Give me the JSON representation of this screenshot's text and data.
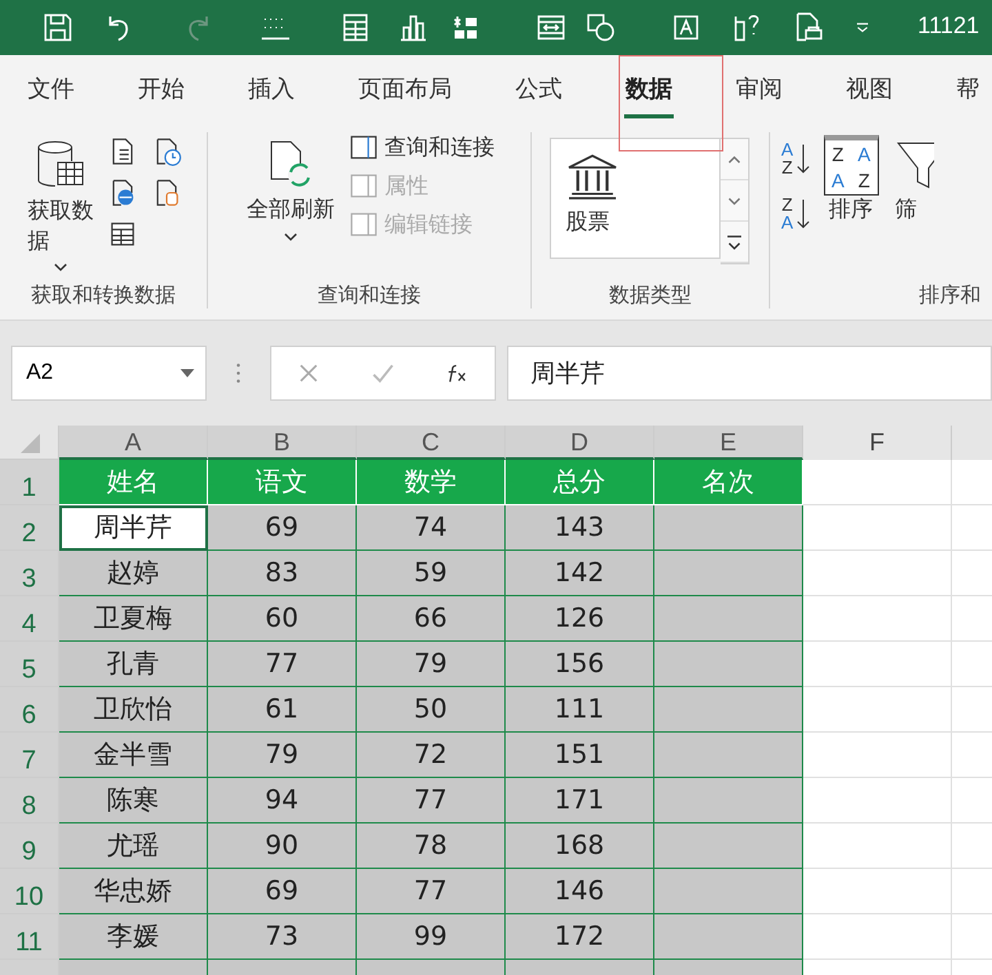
{
  "title_bar": {
    "text": "11121"
  },
  "tabs": [
    {
      "label": "文件",
      "selected": false
    },
    {
      "label": "开始",
      "selected": false
    },
    {
      "label": "插入",
      "selected": false
    },
    {
      "label": "页面布局",
      "selected": false
    },
    {
      "label": "公式",
      "selected": false
    },
    {
      "label": "数据",
      "selected": true
    },
    {
      "label": "审阅",
      "selected": false
    },
    {
      "label": "视图",
      "selected": false
    },
    {
      "label": "帮",
      "selected": false
    }
  ],
  "ribbon": {
    "groups": [
      {
        "label": "获取和转换数据",
        "big": {
          "label": "获取数据"
        }
      },
      {
        "label": "查询和连接",
        "big": {
          "label": "全部刷新"
        },
        "small": [
          {
            "label": "查询和连接",
            "disabled": false
          },
          {
            "label": "属性",
            "disabled": true
          },
          {
            "label": "编辑链接",
            "disabled": true
          }
        ]
      },
      {
        "label": "数据类型",
        "gallery": {
          "label": "股票"
        }
      },
      {
        "label": "排序和",
        "big": {
          "label": "排序"
        },
        "extra": "筛",
        "sort_icons": [
          {
            "top": "A",
            "bottom": "Z"
          },
          {
            "top": "Z",
            "bottom": "A"
          }
        ],
        "sort_grid": [
          "Z",
          "A",
          "A",
          "Z"
        ]
      }
    ]
  },
  "formula_bar": {
    "name_box": "A2",
    "value": "周半芹"
  },
  "columns": [
    "A",
    "B",
    "C",
    "D",
    "E",
    "F"
  ],
  "header_row": {
    "num": "1",
    "cells": [
      "姓名",
      "语文",
      "数学",
      "总分",
      "名次"
    ]
  },
  "rows": [
    {
      "num": "2",
      "cells": [
        "周半芹",
        "69",
        "74",
        "143"
      ],
      "selected": true,
      "active": true
    },
    {
      "num": "3",
      "cells": [
        "赵婷",
        "83",
        "59",
        "142"
      ],
      "selected": true,
      "active": false
    },
    {
      "num": "4",
      "cells": [
        "卫夏梅",
        "60",
        "66",
        "126"
      ],
      "selected": true,
      "active": false
    },
    {
      "num": "5",
      "cells": [
        "孔青",
        "77",
        "79",
        "156"
      ],
      "selected": true,
      "active": false
    },
    {
      "num": "6",
      "cells": [
        "卫欣怡",
        "61",
        "50",
        "111"
      ],
      "selected": true,
      "active": false
    },
    {
      "num": "7",
      "cells": [
        "金半雪",
        "79",
        "72",
        "151"
      ],
      "selected": true,
      "active": false
    },
    {
      "num": "8",
      "cells": [
        "陈寒",
        "94",
        "77",
        "171"
      ],
      "selected": true,
      "active": false
    },
    {
      "num": "9",
      "cells": [
        "尤瑶",
        "90",
        "78",
        "168"
      ],
      "selected": true,
      "active": false
    },
    {
      "num": "10",
      "cells": [
        "华忠娇",
        "69",
        "77",
        "146"
      ],
      "selected": true,
      "active": false
    },
    {
      "num": "11",
      "cells": [
        "李媛",
        "73",
        "99",
        "172"
      ],
      "selected": true,
      "active": false
    }
  ]
}
